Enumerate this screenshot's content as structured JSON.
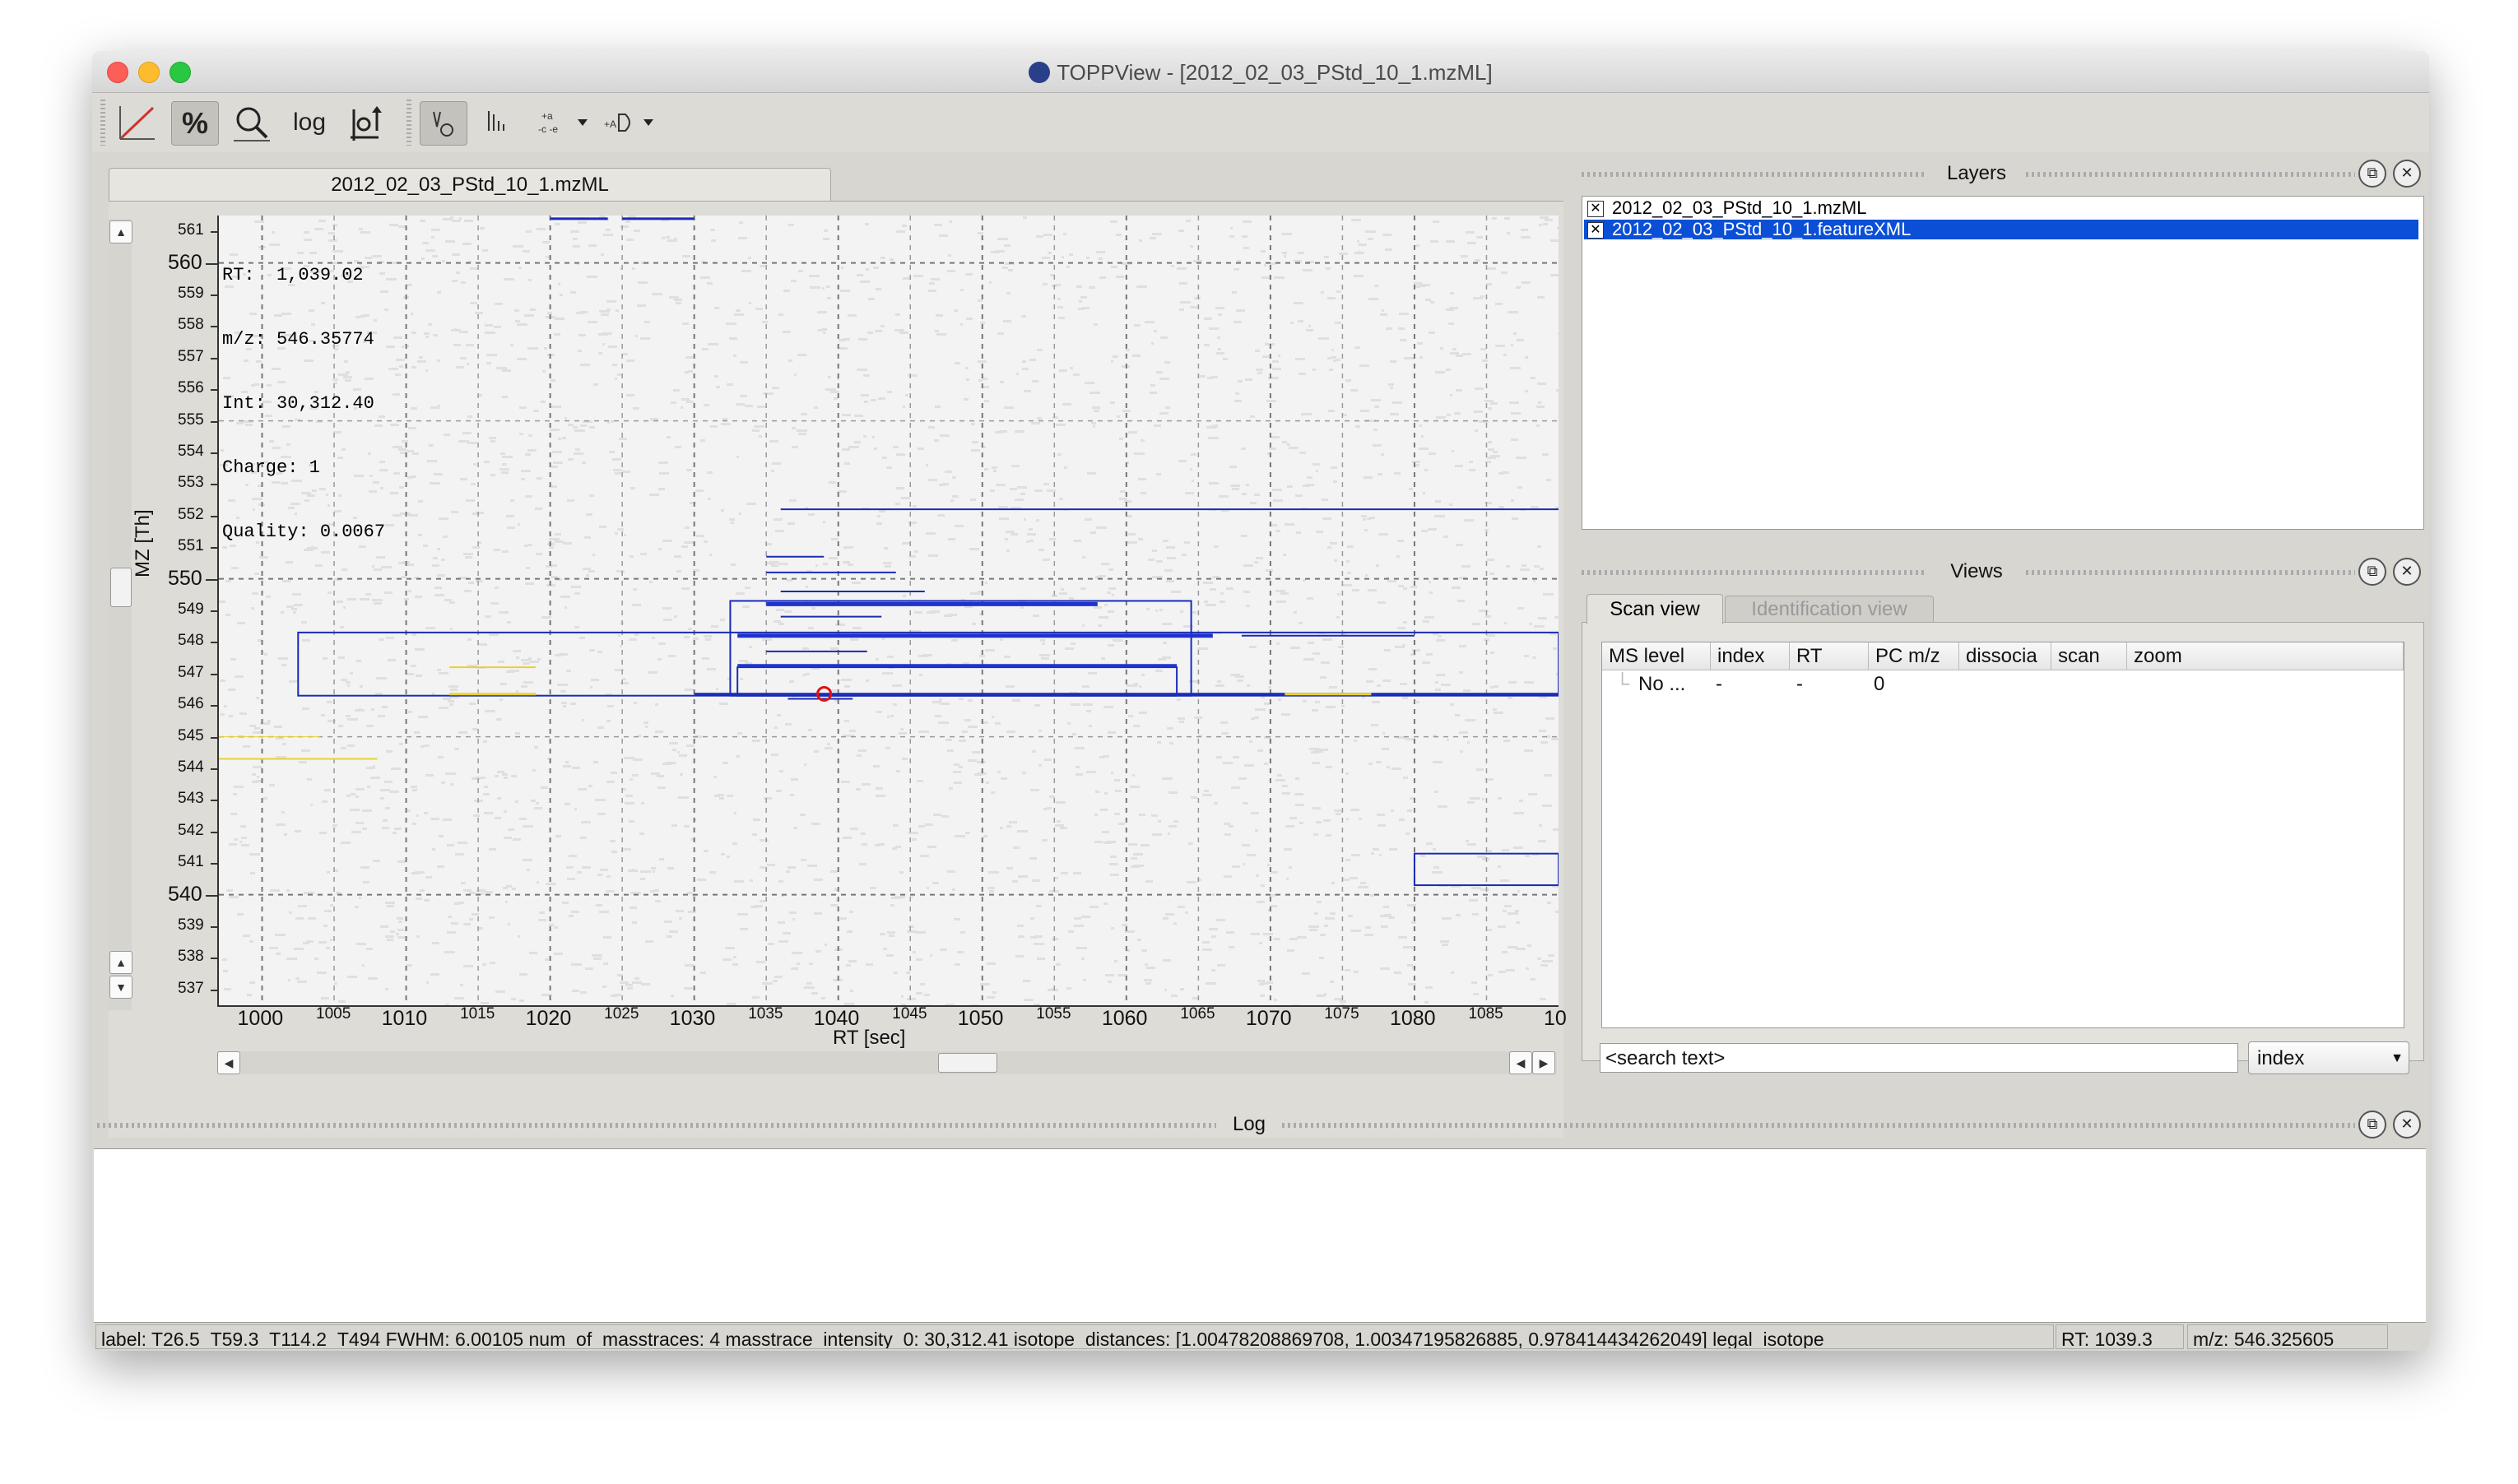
{
  "window": {
    "title": "TOPPView - [2012_02_03_PStd_10_1.mzML]",
    "traffic_lights": [
      "close-red",
      "minimize-yellow",
      "zoom-green"
    ]
  },
  "toolbar": {
    "buttons": [
      {
        "name": "linear-intensity",
        "icon": "diagonal-line-icon"
      },
      {
        "name": "percentage-intensity",
        "icon": "percent-icon",
        "label": "%",
        "active": true
      },
      {
        "name": "snap-intensity",
        "icon": "magnifier-icon"
      },
      {
        "name": "log-intensity",
        "label": "log"
      },
      {
        "name": "show-projections",
        "icon": "axes-arrow-icon"
      },
      {
        "name": "show-peaks",
        "icon": "peaks-icon"
      },
      {
        "name": "show-centroids",
        "icon": "centroid-icon"
      },
      {
        "name": "show-features",
        "icon": "feature-icon"
      },
      {
        "name": "label-options",
        "icon": "label-icon"
      }
    ]
  },
  "plot": {
    "tab_label": "2012_02_03_PStd_10_1.mzML",
    "info_lines": [
      "RT:  1,039.02",
      "m/z: 546.35774",
      "Int: 30,312.40",
      "Charge: 1",
      "Quality: 0.0067"
    ],
    "x_label": "RT [sec]",
    "y_label": "MZ [Th]",
    "x_major_ticks": [
      "1000",
      "1010",
      "1020",
      "1030",
      "1040",
      "1050",
      "1060",
      "1070",
      "1080",
      "10"
    ],
    "x_minor_ticks": [
      "1005",
      "1015",
      "1025",
      "1035",
      "1045",
      "1055",
      "1065",
      "1075",
      "1085"
    ],
    "y_ticks": [
      "561",
      "560",
      "559",
      "558",
      "557",
      "556",
      "555",
      "554",
      "553",
      "552",
      "551",
      "550",
      "549",
      "548",
      "547",
      "546",
      "545",
      "544",
      "543",
      "542",
      "541",
      "540",
      "539",
      "538",
      "537"
    ],
    "x_range": [
      997,
      1090
    ],
    "y_range": [
      536.5,
      561.5
    ],
    "cursor": {
      "rt": 1039.02,
      "mz": 546.35774
    }
  },
  "layers": {
    "title": "Layers",
    "items": [
      {
        "label": "2012_02_03_PStd_10_1.mzML",
        "checked": "✕",
        "selected": false
      },
      {
        "label": "2012_02_03_PStd_10_1.featureXML",
        "checked": "✕",
        "selected": true
      }
    ]
  },
  "views": {
    "title": "Views",
    "tabs": [
      {
        "label": "Scan view",
        "active": true
      },
      {
        "label": "Identification view",
        "active": false
      }
    ],
    "columns": [
      "MS level",
      "index",
      "RT",
      "PC m/z",
      "dissocia",
      "scan",
      "zoom"
    ],
    "rows": [
      {
        "ms_level": "No ...",
        "index": "-",
        "rt": "-",
        "pc_mz": "0"
      }
    ],
    "search_placeholder": "<search text>",
    "search_field": "index"
  },
  "log": {
    "title": "Log",
    "content": ""
  },
  "status": {
    "feature_info": "label: T26.5_T59.3_T114.2_T494 FWHM: 6.00105 num_of_masstraces: 4 masstrace_intensity_0: 30,312.41 isotope_distances: [1.00478208869708, 1.00347195826885, 0.978414434262049] legal_isotope",
    "rt": "RT:    1039.3",
    "mz": "m/z: 546.325605"
  },
  "colors": {
    "feature_blue": "#1a2bb5",
    "peak_blue": "#1f33cc",
    "peak_yellow": "#e6d13a",
    "cursor_red": "#e01010",
    "selection": "#0a4fd6"
  }
}
